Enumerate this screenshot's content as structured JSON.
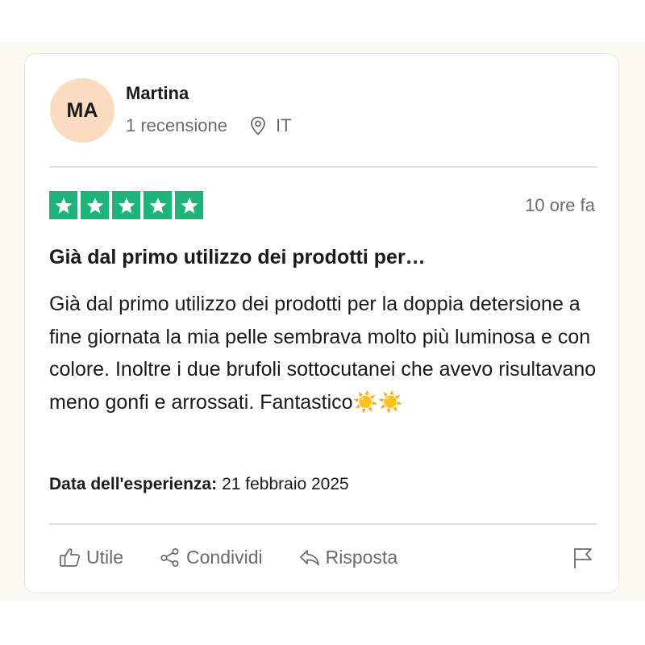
{
  "reviewer": {
    "initials": "MA",
    "name": "Martina",
    "review_count": "1 recensione",
    "country": "IT"
  },
  "review": {
    "rating": 5,
    "rating_max": 5,
    "time_ago": "10 ore fa",
    "title": "Già dal primo utilizzo dei prodotti per…",
    "body": "Già dal primo utilizzo dei prodotti per la doppia detersione a fine giornata la mia pelle sembrava molto più luminosa e con colore. Inoltre i due brufoli sottocutanei che avevo risultavano meno gonfi e arrossati. Fantastico☀️☀️",
    "experience_label": "Data dell'esperienza:",
    "experience_date": "21 febbraio 2025"
  },
  "actions": {
    "useful": "Utile",
    "share": "Condividi",
    "reply": "Risposta"
  },
  "icons": {
    "location": "location-pin-icon",
    "star": "star-icon",
    "useful": "thumbs-up-icon",
    "share": "share-icon",
    "reply": "reply-icon",
    "flag": "flag-icon"
  },
  "colors": {
    "star_green": "#1db47a",
    "avatar_bg": "#fbdcc0",
    "muted_text": "#6b6b6b",
    "page_band": "#fcfbf3"
  }
}
